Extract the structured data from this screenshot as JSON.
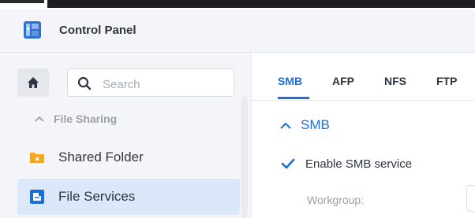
{
  "window": {
    "title": "Control Panel"
  },
  "sidebar": {
    "search": {
      "placeholder": "Search",
      "value": ""
    },
    "group": {
      "label": "File Sharing",
      "expanded": true
    },
    "items": [
      {
        "label": "Shared Folder",
        "icon": "folder-icon",
        "color": "#f5a623",
        "active": false
      },
      {
        "label": "File Services",
        "icon": "file-services-icon",
        "color": "#1a6fd6",
        "active": true
      }
    ]
  },
  "main": {
    "tabs": [
      {
        "label": "SMB",
        "active": true
      },
      {
        "label": "AFP",
        "active": false
      },
      {
        "label": "NFS",
        "active": false
      },
      {
        "label": "FTP",
        "active": false
      }
    ],
    "section": {
      "title": "SMB",
      "expanded": true
    },
    "enable_smb": {
      "label": "Enable SMB service",
      "checked": true
    },
    "workgroup": {
      "label": "Workgroup:",
      "value": ""
    }
  },
  "colors": {
    "accent": "#1a6fd6",
    "sidebar_bg": "#f3f5f8",
    "active_bg": "#dbe8fa"
  }
}
